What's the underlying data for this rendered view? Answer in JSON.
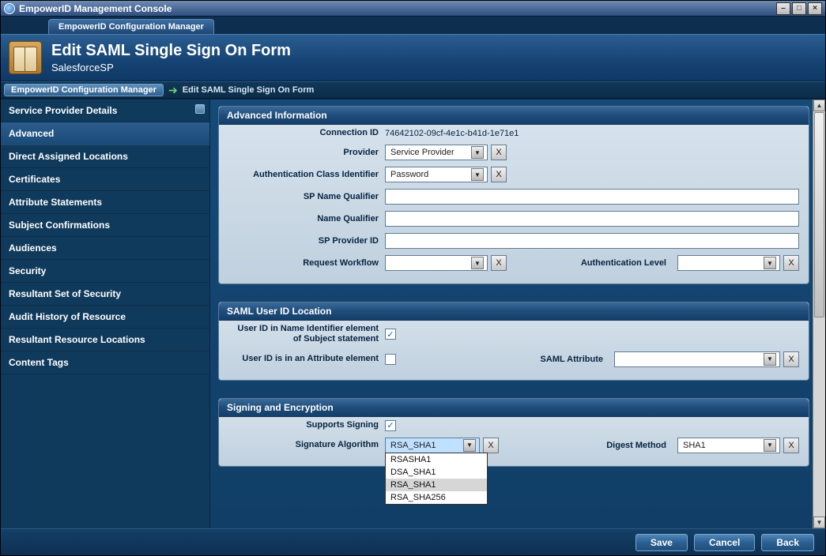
{
  "window": {
    "title": "EmpowerID Management Console"
  },
  "tab": {
    "label": "EmpowerID Configuration Manager"
  },
  "header": {
    "title": "Edit SAML Single Sign On Form",
    "subtitle": "SalesforceSP"
  },
  "breadcrumb": {
    "root": "EmpowerID Configuration Manager",
    "current": "Edit SAML Single Sign On Form"
  },
  "sidebar": {
    "items": [
      {
        "label": "Service Provider Details"
      },
      {
        "label": "Advanced"
      },
      {
        "label": "Direct Assigned Locations"
      },
      {
        "label": "Certificates"
      },
      {
        "label": "Attribute Statements"
      },
      {
        "label": "Subject Confirmations"
      },
      {
        "label": "Audiences"
      },
      {
        "label": "Security"
      },
      {
        "label": "Resultant Set of Security"
      },
      {
        "label": "Audit History of Resource"
      },
      {
        "label": "Resultant Resource Locations"
      },
      {
        "label": "Content Tags"
      }
    ]
  },
  "panels": {
    "advanced": {
      "title": "Advanced Information",
      "connection_id_label": "Connection ID",
      "connection_id_value": "74642102-09cf-4e1c-b41d-1e71e1",
      "provider_label": "Provider",
      "provider_value": "Service Provider",
      "auth_class_label": "Authentication Class Identifier",
      "auth_class_value": "Password",
      "sp_name_qual_label": "SP Name Qualifier",
      "name_qual_label": "Name Qualifier",
      "sp_provider_id_label": "SP Provider ID",
      "request_workflow_label": "Request Workflow",
      "auth_level_label": "Authentication Level"
    },
    "samluid": {
      "title": "SAML User ID Location",
      "uid_name_id_label": "User ID in Name Identifier element of Subject statement",
      "uid_attr_label": "User ID is in an Attribute element",
      "saml_attr_label": "SAML Attribute"
    },
    "signing": {
      "title": "Signing and Encryption",
      "supports_signing_label": "Supports Signing",
      "sig_alg_label": "Signature Algorithm",
      "sig_alg_value": "RSA_SHA1",
      "sig_alg_options": [
        "RSASHA1",
        "DSA_SHA1",
        "RSA_SHA1",
        "RSA_SHA256"
      ],
      "digest_label": "Digest Method",
      "digest_value": "SHA1"
    }
  },
  "buttons": {
    "save": "Save",
    "cancel": "Cancel",
    "back": "Back",
    "clear": "X"
  }
}
